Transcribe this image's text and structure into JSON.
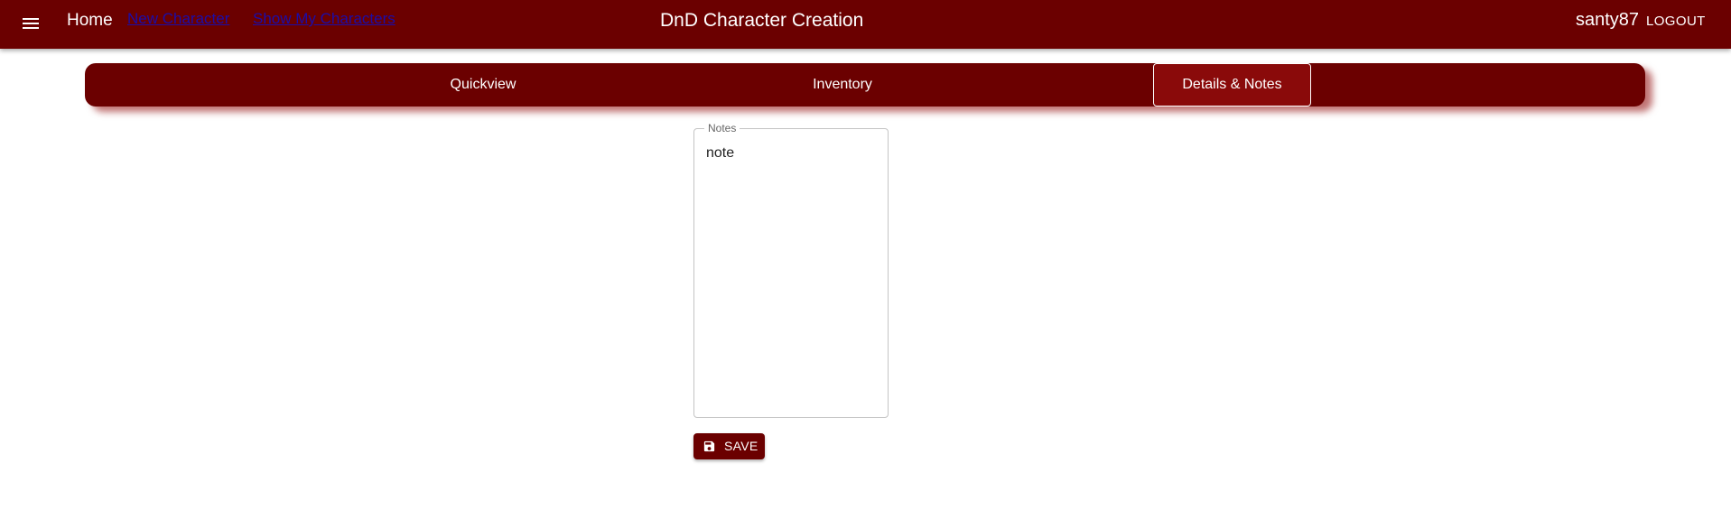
{
  "header": {
    "menu_icon": "hamburger-menu-icon",
    "home_label": "Home",
    "links": {
      "new_character": "New Character",
      "show_my_characters": "Show My Characters"
    },
    "title": "DnD Character Creation",
    "username": "santy87",
    "logout_label": "LOGOUT"
  },
  "tabs": [
    {
      "label": "Quickview",
      "active": false
    },
    {
      "label": "Inventory",
      "active": false
    },
    {
      "label": "Details & Notes",
      "active": true
    }
  ],
  "notes": {
    "legend": "Notes",
    "value": "note"
  },
  "save_button": {
    "icon": "floppy-disk-icon",
    "label": "SAVE"
  },
  "colors": {
    "primary": "#6b0000",
    "active_tab": "#8a0a0a",
    "link": "#1a0dab"
  }
}
